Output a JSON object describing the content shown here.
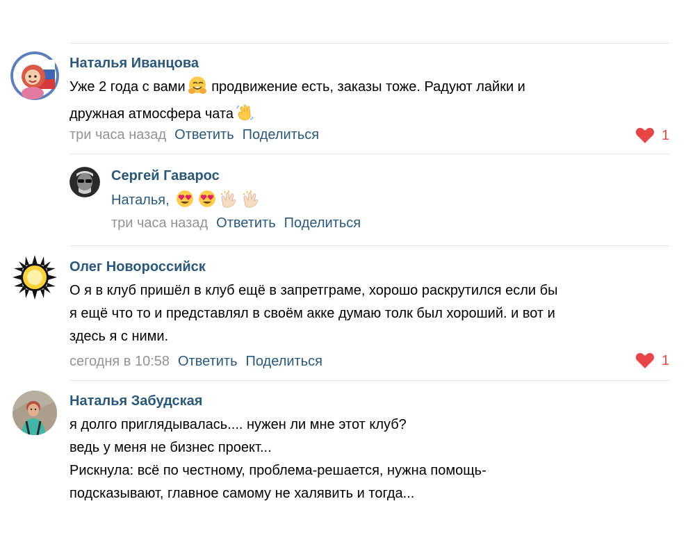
{
  "comments": [
    {
      "author": "Наталья Иванцова",
      "lines": [
        "Уже 2 года с вами",
        " продвижение есть, заказы тоже. Радуют лайки и",
        "дружная атмосфера чата"
      ],
      "time": "три часа назад",
      "reply": "Ответить",
      "share": "Поделиться",
      "likes": "1"
    },
    {
      "author": "Сергей Гаварос",
      "reply_to": "Наталья,",
      "time": "три часа назад",
      "reply": "Ответить",
      "share": "Поделиться"
    },
    {
      "author": "Олег Новороссийск",
      "lines": [
        "О я в клуб пришёл в клуб ещё в запретграме, хорошо раскрутился если бы",
        "я ещё что то и представлял в своём акке думаю толк был хороший. и вот и",
        "здесь я с ними."
      ],
      "time": "сегодня в 10:58",
      "reply": "Ответить",
      "share": "Поделиться",
      "likes": "1"
    },
    {
      "author": "Наталья Забудская",
      "lines": [
        "я долго приглядывалась.... нужен ли мне этот клуб?",
        "ведь у меня не бизнес проект...",
        "Рискнула: всё по честному, проблема-решается, нужна помощь-",
        "подсказывают, главное самому не халявить и тогда..."
      ]
    }
  ],
  "icons": {
    "emoji_1": "smiling-hands-emoji",
    "emoji_2": "waving-hand-emoji",
    "emoji_heart_eyes": "heart-eyes-emoji",
    "emoji_clap": "clapping-hands-emoji",
    "like": "heart-icon"
  },
  "colors": {
    "author": "#2b587a",
    "meta": "#939393",
    "like": "#e64646",
    "divider": "#e3e5e8"
  }
}
